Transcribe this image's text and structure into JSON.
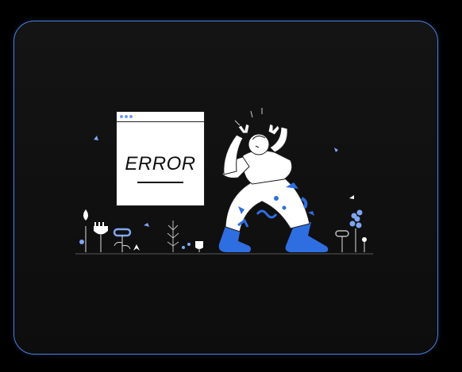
{
  "error_window": {
    "label": "ERROR"
  },
  "colors": {
    "accent": "#4a7fe0",
    "illustration_blue": "#2f6ee0",
    "light_blue": "#7fa6f2",
    "background": "#000000",
    "card": "#121212"
  },
  "icons": [
    "error-window",
    "frustrated-person-illustration",
    "plant-decoration",
    "sparkle-decoration"
  ]
}
